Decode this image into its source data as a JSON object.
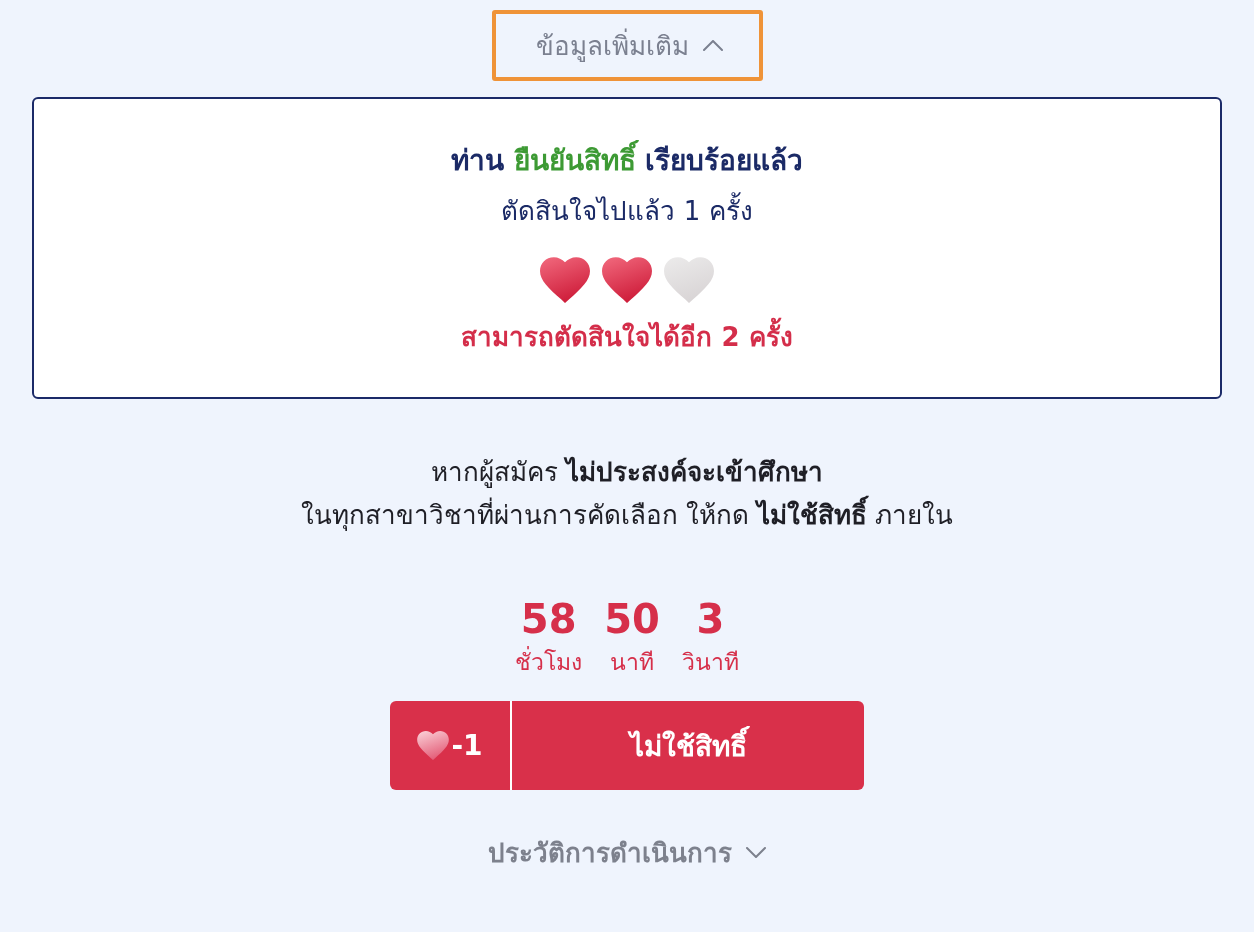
{
  "more_info": {
    "label": "ข้อมูลเพิ่มเติม",
    "expanded": true,
    "focused": true
  },
  "status_card": {
    "title": [
      {
        "text": "ท่าน",
        "kind": "plain"
      },
      {
        "text": "ยืนยันสิทธิ์",
        "kind": "highlight"
      },
      {
        "text": "เรียบร้อยแล้ว",
        "kind": "plain"
      }
    ],
    "subtitle": "ตัดสินใจไปแล้ว 1 ครั้ง",
    "hearts": [
      {
        "filled": true
      },
      {
        "filled": true
      },
      {
        "filled": false
      }
    ],
    "remaining": "สามารถตัดสินใจได้อีก 2 ครั้ง"
  },
  "notice": {
    "lines": [
      "หากผู้สมัคร **ไม่ประสงค์จะเข้าศึกษา**",
      "ในทุกสาขาวิชาที่ผ่านการคัดเลือก ให้กด **ไม่ใช้สิทธิ์** ภายใน"
    ]
  },
  "countdown": [
    {
      "value": "58",
      "unit": "ชั่วโมง"
    },
    {
      "value": "50",
      "unit": "นาที"
    },
    {
      "value": "3",
      "unit": "วินาที"
    }
  ],
  "decline_button": {
    "cost": "-1",
    "label": "ไม่ใช้สิทธิ์"
  },
  "history": {
    "label": "ประวัติการดำเนินการ",
    "expanded": false
  }
}
